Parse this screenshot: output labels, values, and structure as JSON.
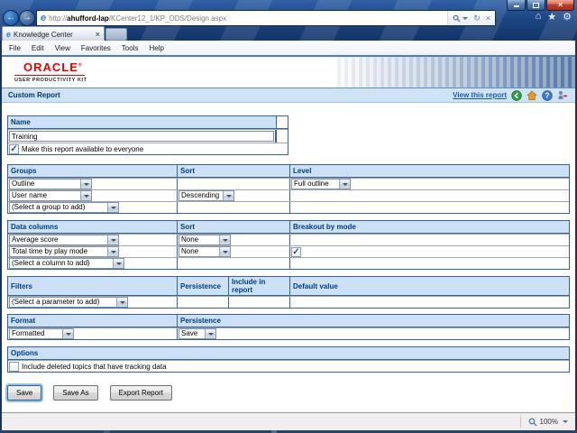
{
  "colors": {
    "section_header_bg": "#cde1f6",
    "section_header_text": "#003d79",
    "table_border": "#31639c",
    "oracle_red": "#e90000",
    "link_blue": "#1a5dab",
    "chrome_glass_blue": "#1c4684"
  },
  "icons": {
    "minimize": "–",
    "close": "×",
    "back_arrow": "←",
    "forward_arrow": "→",
    "ie_logo": "e",
    "refresh": "↻",
    "stop": "×",
    "home": "⌂",
    "star": "★",
    "gear": "⚙",
    "tab_close": "×"
  },
  "browser": {
    "url": {
      "prefix": "http://",
      "host": "ahufford-lap",
      "path": "/KCenter12_1/KP_ODS/Design.aspx"
    },
    "tab_title": "Knowledge Center",
    "menu_items": [
      "File",
      "Edit",
      "View",
      "Favorites",
      "Tools",
      "Help"
    ]
  },
  "branding": {
    "logo": "ORACLE",
    "registered": "®",
    "product": "USER PRODUCTIVITY KIT"
  },
  "page_header": {
    "title": "Custom Report",
    "view_report_link": "View this report"
  },
  "name_section": {
    "header": "Name",
    "value": "Training",
    "checkbox_label": "Make this report available to everyone",
    "checkbox_checked": true
  },
  "groups_section": {
    "headers": [
      "Groups",
      "Sort",
      "Level"
    ],
    "rows": [
      {
        "group": "Outline",
        "level": "Full outline"
      },
      {
        "group": "User name",
        "sort": "Descending"
      },
      {
        "group": "(Select a group to add)"
      }
    ]
  },
  "data_columns_section": {
    "headers": [
      "Data columns",
      "Sort",
      "Breakout by mode"
    ],
    "rows": [
      {
        "column": "Average score",
        "sort": "None"
      },
      {
        "column": "Total time by play mode",
        "sort": "None",
        "breakout_checked": true
      },
      {
        "column": "(Select a column to add)"
      }
    ]
  },
  "filters_section": {
    "headers": [
      "Filters",
      "Persistence",
      "Include in report",
      "Default value"
    ],
    "rows": [
      {
        "filter": "(Select a parameter to add)"
      }
    ]
  },
  "format_section": {
    "headers": [
      "Format",
      "Persistence"
    ],
    "format_value": "Formatted",
    "persistence_value": "Save"
  },
  "options_section": {
    "header": "Options",
    "checkbox_label": "Include deleted topics that have tracking data",
    "checkbox_checked": false
  },
  "buttons": {
    "save": "Save",
    "save_as": "Save As",
    "export_report": "Export Report"
  },
  "statusbar": {
    "zoom_level": "100%"
  }
}
